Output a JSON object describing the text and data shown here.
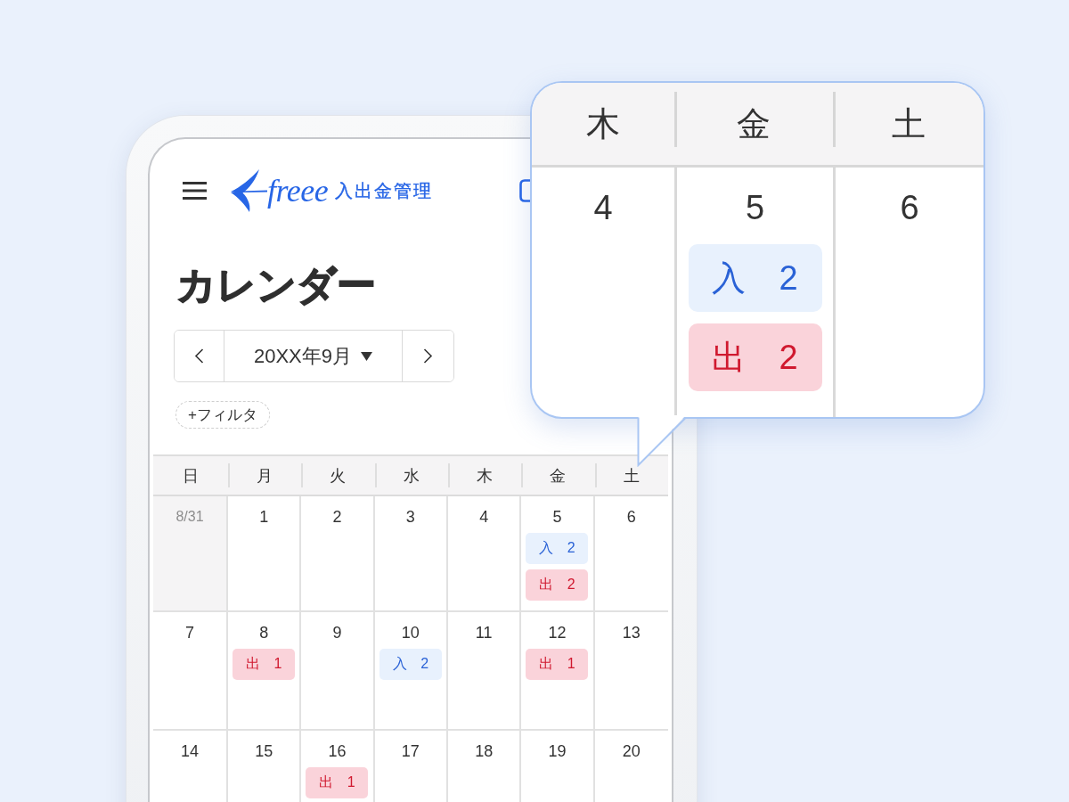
{
  "header": {
    "logo_text": "freee",
    "app_name": "入出金管理"
  },
  "page_title": "カレンダー",
  "month_nav": {
    "label": "20XX年9月"
  },
  "filter_button": {
    "label": "+フィルタ"
  },
  "calendar": {
    "weekdays": [
      "日",
      "月",
      "火",
      "水",
      "木",
      "金",
      "土"
    ],
    "weeks": [
      [
        {
          "day": "8/31",
          "other_month": true
        },
        {
          "day": "1",
          "other_month": false
        },
        {
          "day": "2",
          "other_month": false
        },
        {
          "day": "3",
          "other_month": false
        },
        {
          "day": "4",
          "other_month": false
        },
        {
          "day": "5",
          "other_month": false,
          "entries": [
            {
              "kind": "deposit",
              "text": "入 2"
            },
            {
              "kind": "withdrawal",
              "text": "出 2"
            }
          ]
        },
        {
          "day": "6",
          "other_month": false
        }
      ],
      [
        {
          "day": "7",
          "other_month": false
        },
        {
          "day": "8",
          "other_month": false,
          "entries": [
            {
              "kind": "withdrawal",
              "text": "出 1"
            }
          ]
        },
        {
          "day": "9",
          "other_month": false
        },
        {
          "day": "10",
          "other_month": false,
          "entries": [
            {
              "kind": "deposit",
              "text": "入 2"
            }
          ]
        },
        {
          "day": "11",
          "other_month": false
        },
        {
          "day": "12",
          "other_month": false,
          "entries": [
            {
              "kind": "withdrawal",
              "text": "出 1"
            }
          ]
        },
        {
          "day": "13",
          "other_month": false
        }
      ],
      [
        {
          "day": "14",
          "other_month": false
        },
        {
          "day": "15",
          "other_month": false
        },
        {
          "day": "16",
          "other_month": false,
          "entries": [
            {
              "kind": "withdrawal",
              "text": "出 1"
            }
          ]
        },
        {
          "day": "17",
          "other_month": false
        },
        {
          "day": "18",
          "other_month": false
        },
        {
          "day": "19",
          "other_month": false
        },
        {
          "day": "20",
          "other_month": false
        }
      ]
    ]
  },
  "callout": {
    "weekdays": [
      "木",
      "金",
      "土"
    ],
    "days": [
      {
        "day": "4"
      },
      {
        "day": "5",
        "entries": [
          {
            "kind": "deposit",
            "text": "入 2"
          },
          {
            "kind": "withdrawal",
            "text": "出 2"
          }
        ]
      },
      {
        "day": "6"
      }
    ]
  }
}
